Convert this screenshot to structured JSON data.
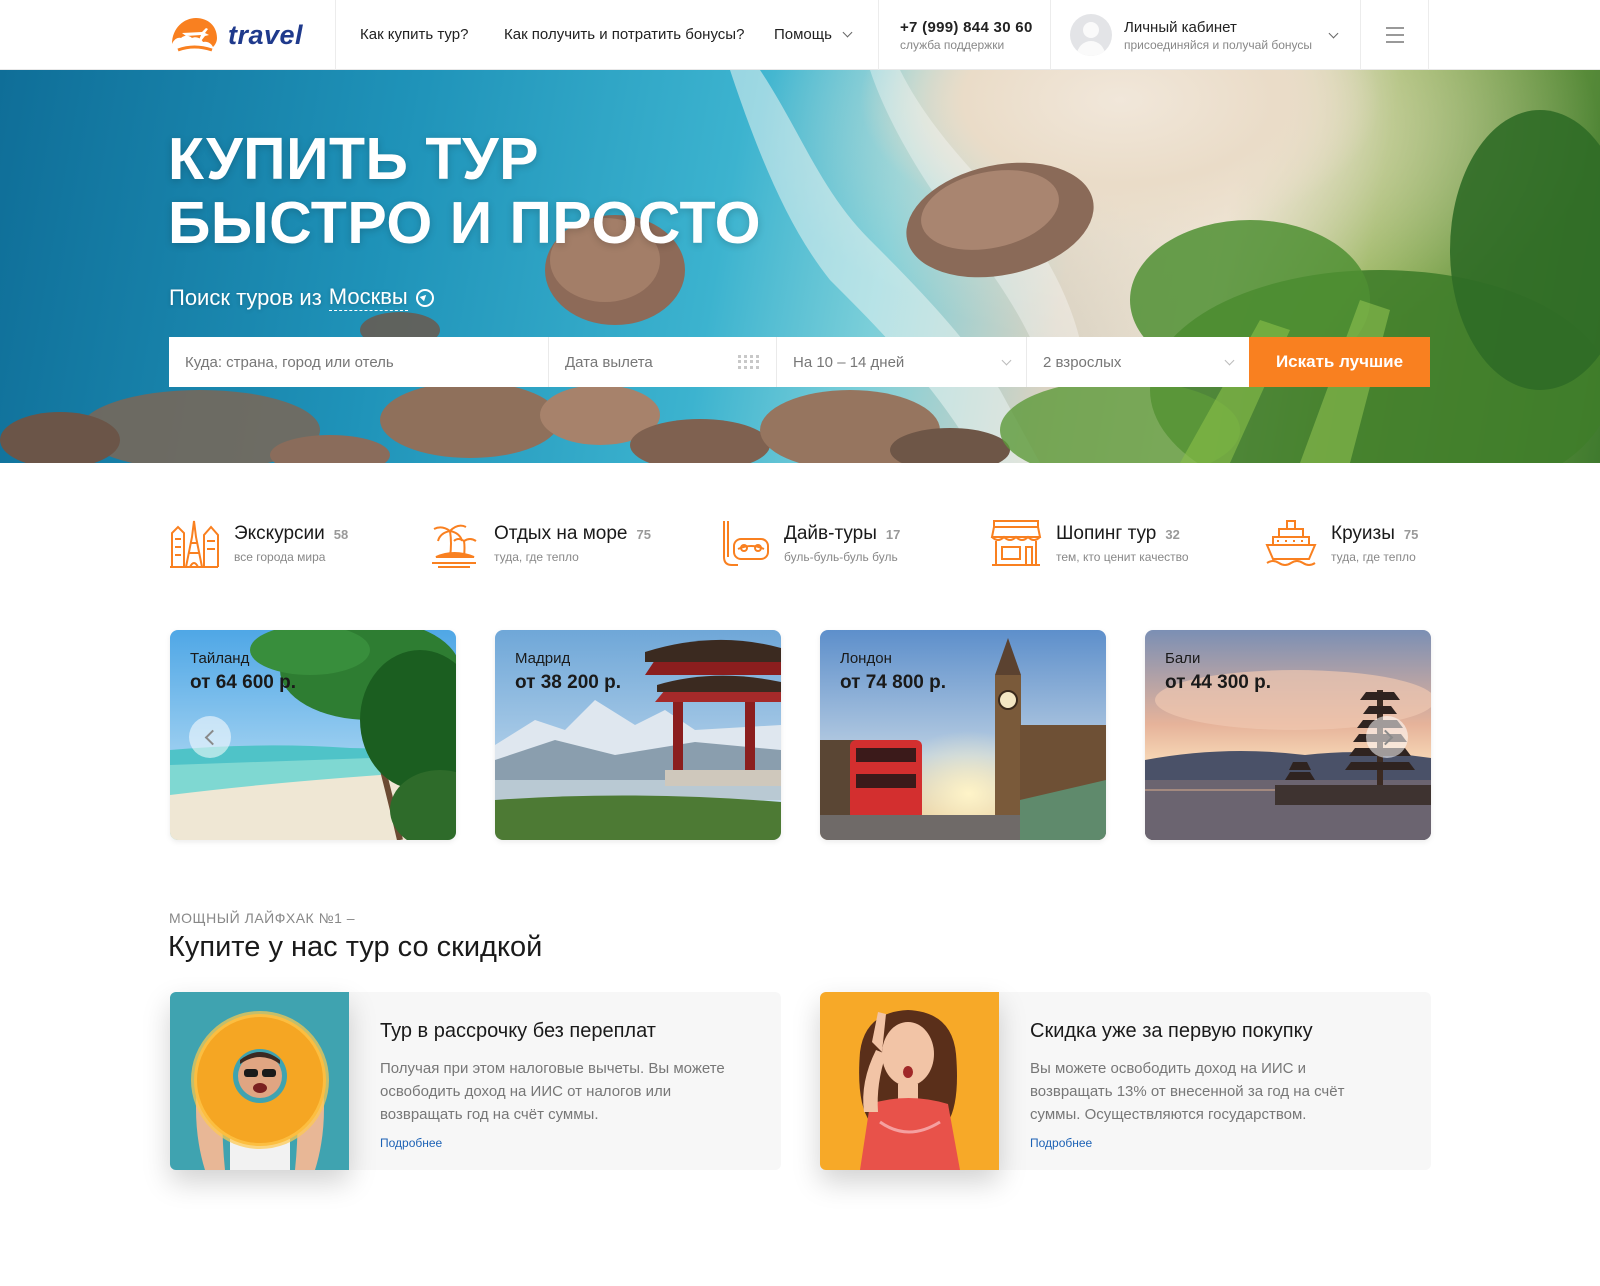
{
  "header": {
    "logo_text": "travel",
    "nav": [
      {
        "label": "Как купить тур?"
      },
      {
        "label": "Как получить и потратить бонусы?"
      },
      {
        "label": "Помощь"
      }
    ],
    "phone": "+7 (999) 844 30 60",
    "phone_caption": "служба поддержки",
    "account_title": "Личный кабинет",
    "account_subtitle": "присоединяйся и получай бонусы"
  },
  "hero": {
    "title_line1": "КУПИТЬ ТУР",
    "title_line2": "БЫСТРО И ПРОСТО",
    "search_prefix": "Поиск туров из",
    "search_city": "Москвы"
  },
  "search": {
    "where_placeholder": "Куда: страна, город или отель",
    "date_placeholder": "Дата вылета",
    "duration": "На 10 – 14 дней",
    "guests": "2 взрослых",
    "button": "Искать лучшие"
  },
  "categories": [
    {
      "title": "Экскурсии",
      "count": "58",
      "subtitle": "все города мира",
      "icon": "eiffel-tower-icon"
    },
    {
      "title": "Отдых на море",
      "count": "75",
      "subtitle": "туда, где тепло",
      "icon": "palm-island-icon"
    },
    {
      "title": "Дайв-туры",
      "count": "17",
      "subtitle": "буль-буль-буль буль",
      "icon": "dive-mask-icon"
    },
    {
      "title": "Шопинг тур",
      "count": "32",
      "subtitle": "тем, кто ценит качество",
      "icon": "shop-icon"
    },
    {
      "title": "Круизы",
      "count": "75",
      "subtitle": "туда, где тепло",
      "icon": "cruise-ship-icon"
    }
  ],
  "destinations": [
    {
      "city": "Тайланд",
      "price": "от 64 600 р."
    },
    {
      "city": "Мадрид",
      "price": "от 38 200 р."
    },
    {
      "city": "Лондон",
      "price": "от 74 800 р."
    },
    {
      "city": "Бали",
      "price": "от 44 300 р."
    }
  ],
  "discount": {
    "overline": "МОЩНЫЙ ЛАЙФХАК №1 –",
    "title": "Купите у нас тур со скидкой",
    "cards": [
      {
        "title": "Тур в рассрочку без переплат",
        "text": "Получая при этом налоговые вычеты. Вы можете освободить доход на ИИС от налогов или возвращать год на счёт суммы.",
        "link": "Подробнее"
      },
      {
        "title": "Скидка уже за первую покупку",
        "text": "Вы можете освободить доход на ИИС и возвращать 13% от внесенной за год на счёт суммы. Осуществляются государством.",
        "link": "Подробнее"
      }
    ]
  },
  "colors": {
    "accent": "#f98020",
    "brand": "#1f3a8c",
    "link": "#1d62b5"
  }
}
